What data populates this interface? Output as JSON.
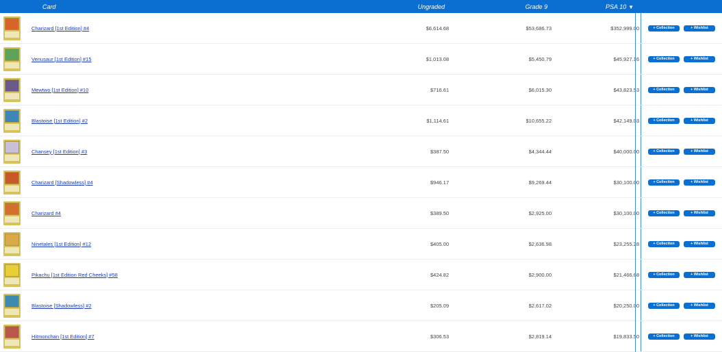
{
  "header": {
    "card": "Card",
    "ungraded": "Ungraded",
    "grade9": "Grade 9",
    "psa10": "PSA 10",
    "sort_indicator": "▼"
  },
  "buttons": {
    "collection": "+ Collection",
    "wishlist": "+ Wishlist"
  },
  "rows": [
    {
      "name": "Charizard [1st Edition] #4",
      "ungraded": "$6,614.68",
      "grade9": "$53,686.73",
      "psa10": "$352,999.00",
      "color": "#d9642a"
    },
    {
      "name": "Venusaur [1st Edition] #15",
      "ungraded": "$1,013.08",
      "grade9": "$5,450.79",
      "psa10": "$45,927.16",
      "color": "#5da45a"
    },
    {
      "name": "Mewtwo [1st Edition] #10",
      "ungraded": "$716.61",
      "grade9": "$6,015.30",
      "psa10": "$43,823.53",
      "color": "#6a5a8a"
    },
    {
      "name": "Blastoise [1st Edition] #2",
      "ungraded": "$1,114.61",
      "grade9": "$10,655.22",
      "psa10": "$42,149.03",
      "color": "#3f86b8"
    },
    {
      "name": "Chansey [1st Edition] #3",
      "ungraded": "$387.50",
      "grade9": "$4,344.44",
      "psa10": "$40,000.00",
      "color": "#c7c0d8"
    },
    {
      "name": "Charizard [Shadowless] #4",
      "ungraded": "$946.17",
      "grade9": "$9,269.44",
      "psa10": "$30,100.00",
      "color": "#c85a2a"
    },
    {
      "name": "Charizard #4",
      "ungraded": "$389.50",
      "grade9": "$2,925.00",
      "psa10": "$30,100.00",
      "color": "#d4702e"
    },
    {
      "name": "Ninetales [1st Edition] #12",
      "ungraded": "$405.00",
      "grade9": "$2,636.98",
      "psa10": "$23,255.28",
      "color": "#d9a94a"
    },
    {
      "name": "Pikachu [1st Edition Red Cheeks] #58",
      "ungraded": "$424.82",
      "grade9": "$2,900.00",
      "psa10": "$21,466.68",
      "color": "#e8cf3a"
    },
    {
      "name": "Blastoise [Shadowless] #2",
      "ungraded": "$205.09",
      "grade9": "$2,617.02",
      "psa10": "$20,250.00",
      "color": "#3f8ab0"
    },
    {
      "name": "Hitmonchan [1st Edition] #7",
      "ungraded": "$306.53",
      "grade9": "$2,819.14",
      "psa10": "$19,833.50",
      "color": "#b9584a"
    }
  ]
}
